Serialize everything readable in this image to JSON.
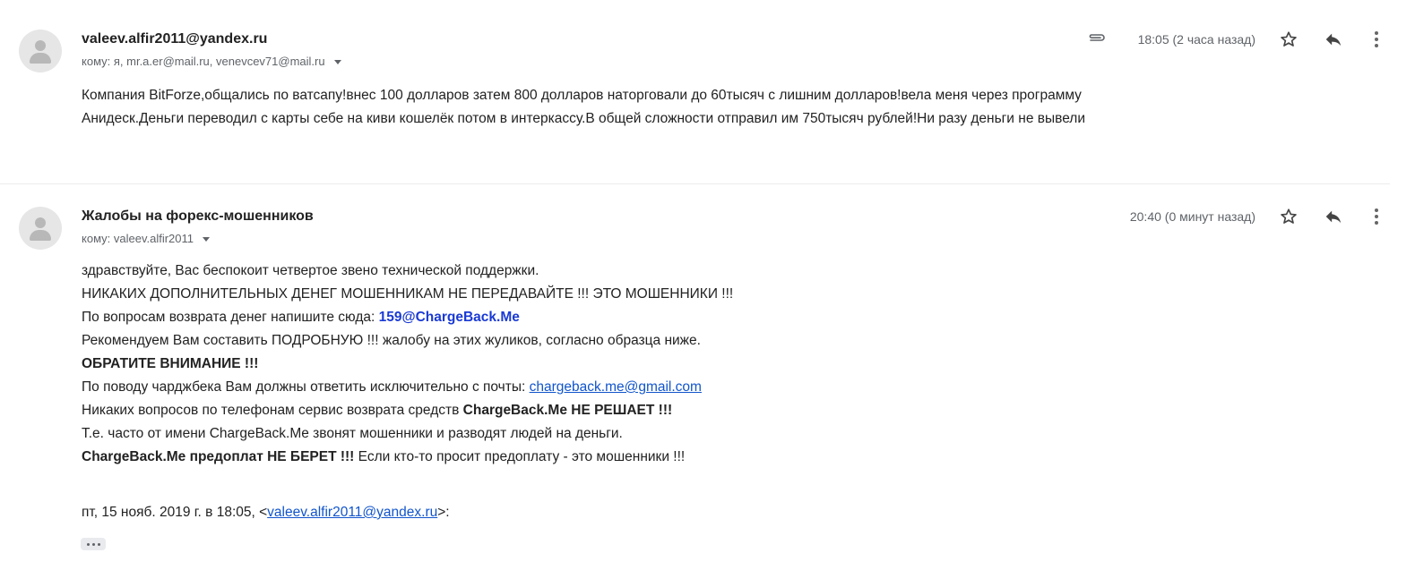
{
  "messages": [
    {
      "sender": "valeev.alfir2011@yandex.ru",
      "recipients": "кому: я, mr.a.er@mail.ru, venevcev71@mail.ru",
      "time": "18:05 (2 часа назад)",
      "has_attachment": true,
      "body_lines": [
        "Компания BitForze,общались по ватсапу!внес 100 долларов затем 800 долларов наторговали до 60тысяч с лишним долларов!вела меня через программу",
        "Анидеск.Деньги переводил с карты себе на киви кошелёк потом в интеркассу.В общей сложности отправил им 750тысяч рублей!Ни разу деньги не вывели"
      ]
    },
    {
      "sender": "Жалобы на форекс-мошенников",
      "recipients": "кому: valeev.alfir2011",
      "time": "20:40 (0 минут назад)",
      "body": {
        "l1": "здравствуйте, Вас беспокоит четвертое звено технической поддержки.",
        "l2": "НИКАКИХ ДОПОЛНИТЕЛЬНЫХ ДЕНЕГ МОШЕННИКАМ НЕ ПЕРЕДАВАЙТЕ !!! ЭТО МОШЕННИКИ !!!",
        "l3_text": "По вопросам возврата денег напишите сюда: ",
        "l3_email": "159@ChargeBack.Me",
        "l4": "Рекомендуем Вам составить ПОДРОБНУЮ !!! жалобу на этих жуликов, согласно образца ниже.",
        "l5": "ОБРАТИТЕ ВНИМАНИЕ !!!",
        "l6_text": "По поводу чарджбека Вам должны ответить исключительно с почты: ",
        "l6_email": "chargeback.me@gmail.com",
        "l7_text": "Никаких вопросов по телефонам сервис возврата средств ",
        "l7_bold": "ChargeBack.Me НЕ РЕШАЕТ !!!",
        "l8": "Т.е. часто от имени ChargeBack.Me звонят мошенники и разводят людей на деньги.",
        "l9_bold": "ChargeBack.Me предоплат НЕ БЕРЕТ !!!",
        "l9_text": " Если кто-то просит предоплату - это мошенники !!!"
      },
      "quote": {
        "prefix": "пт, 15 нояб. 2019 г. в 18:05, <",
        "email": "valeev.alfir2011@yandex.ru",
        "suffix": ">:"
      }
    }
  ],
  "icons": [
    "avatar-icon",
    "attachment-icon",
    "star-icon",
    "reply-icon",
    "more-vertical-icon",
    "ellipsis-icon"
  ],
  "colors": {
    "link": "#1155cc",
    "highlight_email": "#1a3ad4",
    "meta_text": "#5f6368"
  }
}
